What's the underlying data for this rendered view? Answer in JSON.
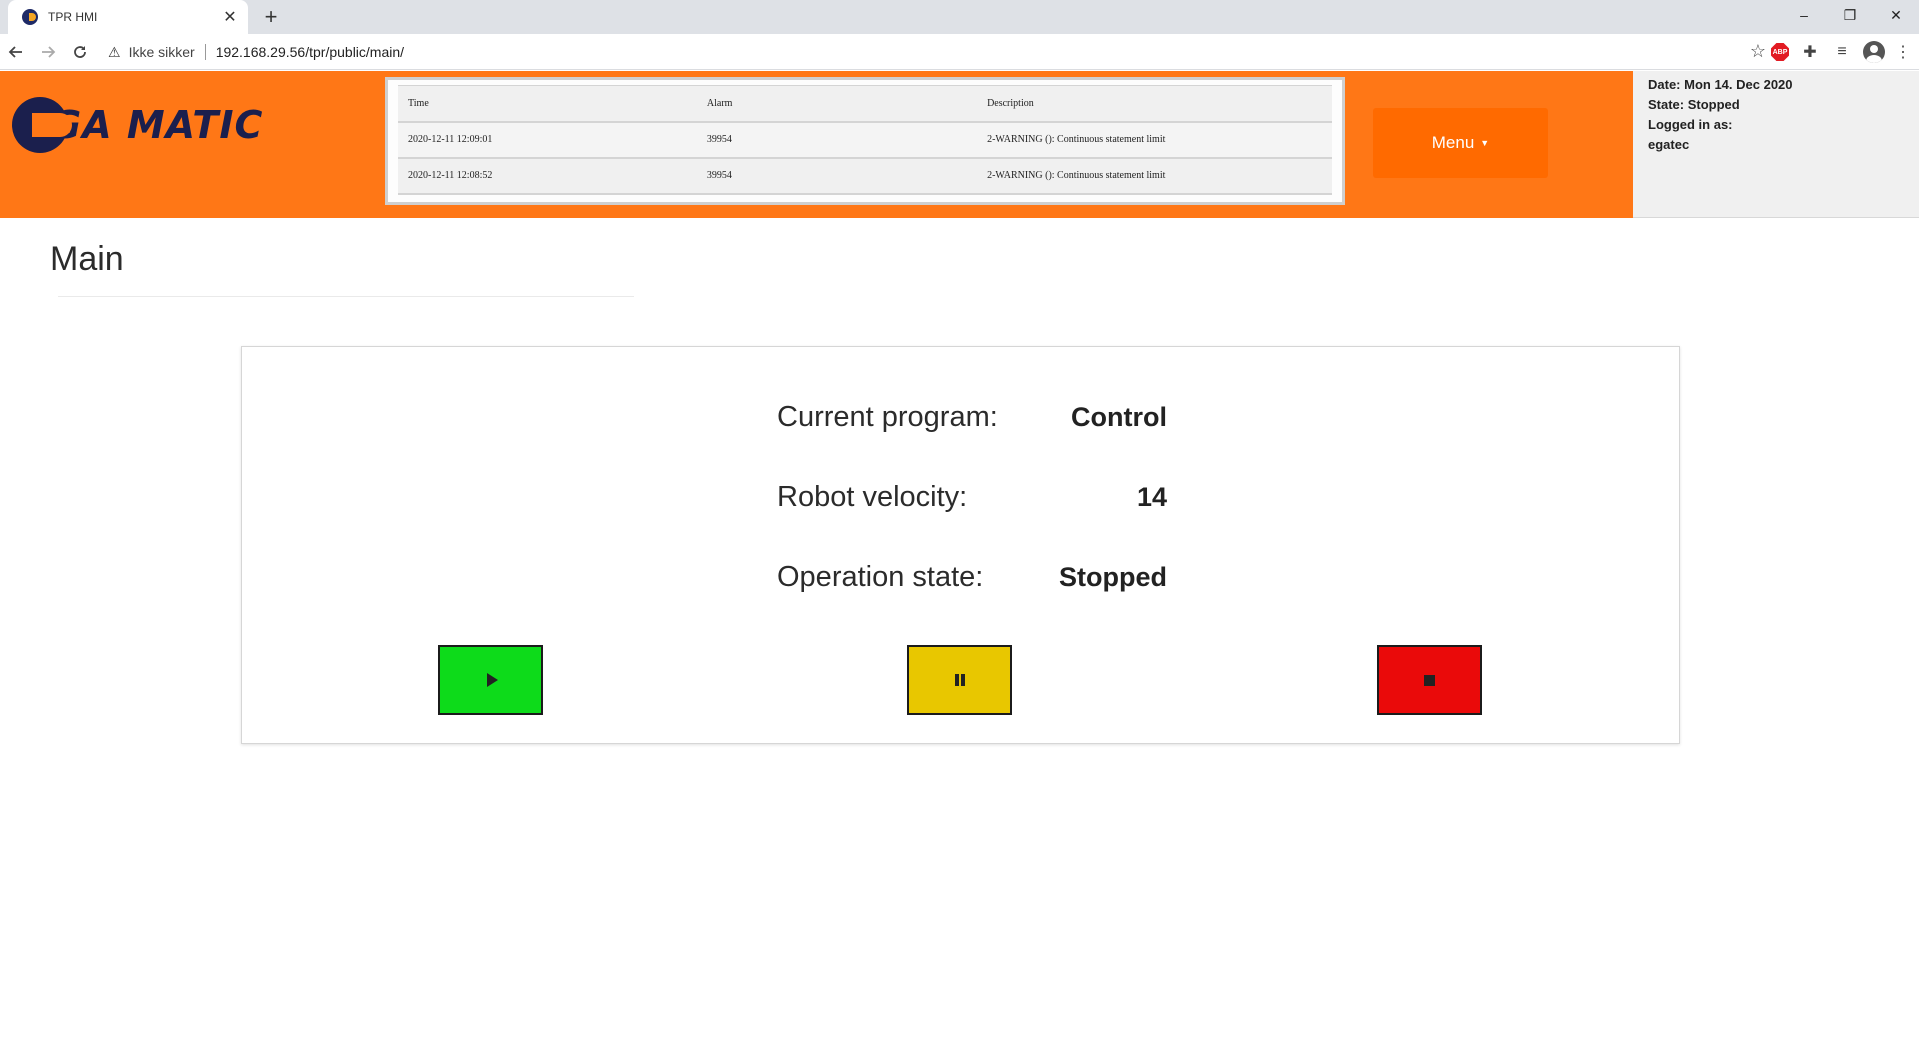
{
  "browser": {
    "tab_title": "TPR HMI",
    "tab_close": "✕",
    "new_tab": "+",
    "security_label": "Ikke sikker",
    "url": "192.168.29.56/tpr/public/main/",
    "window_controls": [
      "–",
      "❐",
      "✕"
    ]
  },
  "header": {
    "logo_text": "GA MATIC",
    "menu_label": "Menu",
    "alarms": {
      "columns": [
        "Time",
        "Alarm",
        "Description"
      ],
      "rows": [
        [
          "2020-12-11 12:09:01",
          "39954",
          "2-WARNING (): Continuous statement limit"
        ],
        [
          "2020-12-11 12:08:52",
          "39954",
          "2-WARNING (): Continuous statement limit"
        ]
      ]
    },
    "info": {
      "date": "Date: Mon 14. Dec 2020",
      "state": "State: Stopped",
      "logged_in_label": "Logged in as:",
      "user": "egatec"
    }
  },
  "main": {
    "title": "Main",
    "status": {
      "program_label": "Current program:",
      "program_value": "Control",
      "velocity_label": "Robot velocity:",
      "velocity_value": "14",
      "state_label": "Operation state:",
      "state_value": "Stopped"
    },
    "controls": [
      {
        "name": "play-button",
        "icon": "play-icon",
        "color": "#0ddb1a"
      },
      {
        "name": "pause-button",
        "icon": "pause-icon",
        "color": "#e8c700"
      },
      {
        "name": "stop-button",
        "icon": "stop-icon",
        "color": "#ea0a0a"
      }
    ]
  },
  "colors": {
    "header_orange": "#ff7716",
    "menu_orange": "#ff6a00",
    "logo_navy": "#1b1f4d"
  }
}
